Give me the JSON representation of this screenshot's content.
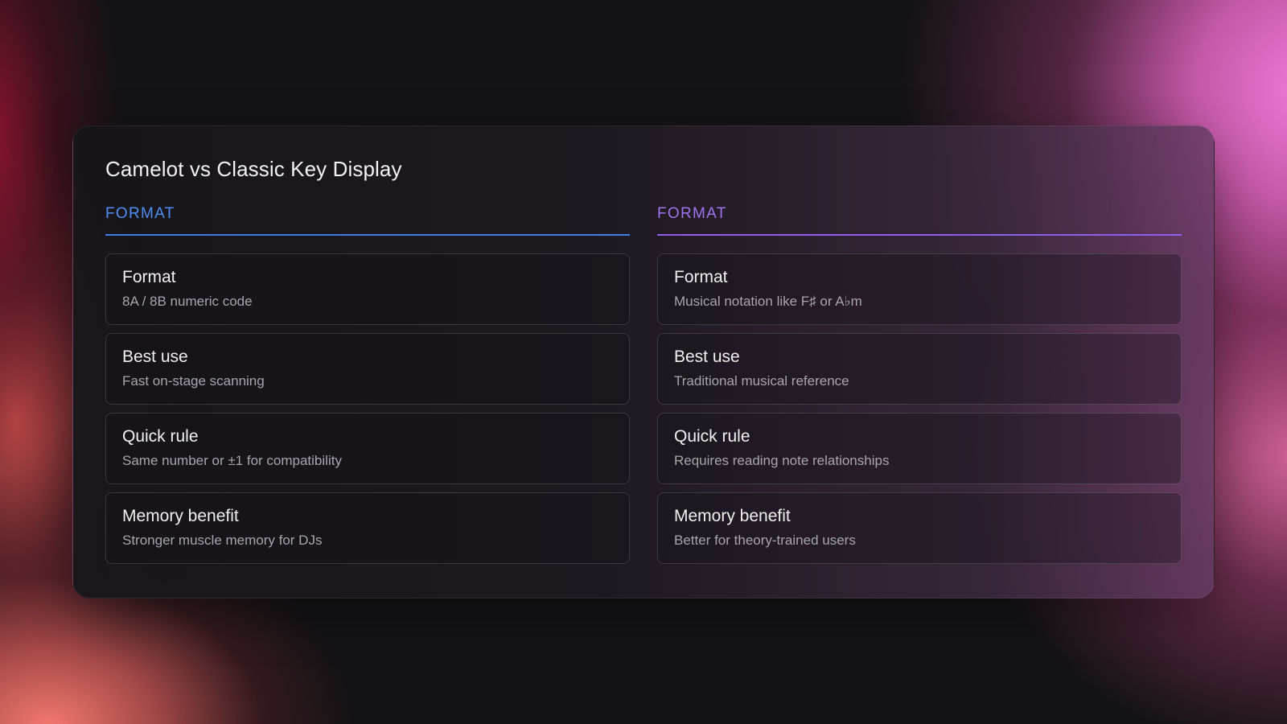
{
  "colors": {
    "accent_left": "#4d8ef5",
    "accent_right": "#a073f0"
  },
  "title": "Camelot vs Classic Key Display",
  "columns": [
    {
      "header": "FORMAT",
      "rows": [
        {
          "label": "Format",
          "value": "8A / 8B numeric code"
        },
        {
          "label": "Best use",
          "value": "Fast on-stage scanning"
        },
        {
          "label": "Quick rule",
          "value": "Same number or ±1 for compatibility"
        },
        {
          "label": "Memory benefit",
          "value": "Stronger muscle memory for DJs"
        }
      ]
    },
    {
      "header": "FORMAT",
      "rows": [
        {
          "label": "Format",
          "value": "Musical notation like F♯ or A♭m"
        },
        {
          "label": "Best use",
          "value": "Traditional musical reference"
        },
        {
          "label": "Quick rule",
          "value": "Requires reading note relationships"
        },
        {
          "label": "Memory benefit",
          "value": "Better for theory-trained users"
        }
      ]
    }
  ]
}
